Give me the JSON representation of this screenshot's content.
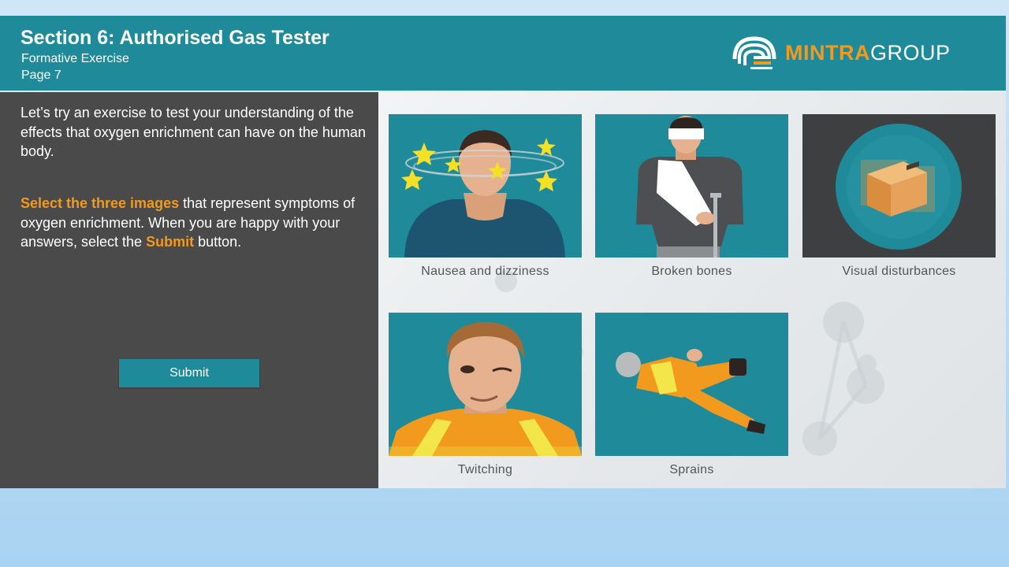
{
  "header": {
    "title": "Section 6: Authorised Gas Tester",
    "subtitle": "Formative Exercise",
    "page": "Page 7",
    "logo": {
      "word1": "MINTRA",
      "word2": "GROUP"
    }
  },
  "left_panel": {
    "intro": "Let’s try an exercise to test your understanding of the effects that oxygen enrichment can have on the human body.",
    "instruction": {
      "highlight": "Select the three images",
      "text1": " that represent symptoms of oxygen enrichment. When you are happy with your answers, select the ",
      "submit_word": "Submit",
      "text2": " button."
    },
    "submit_label": "Submit"
  },
  "options": [
    {
      "label": "Nausea and dizziness",
      "icon": "dizzy-person-icon"
    },
    {
      "label": "Broken bones",
      "icon": "broken-arm-person-icon"
    },
    {
      "label": "Visual disturbances",
      "icon": "blurred-box-icon"
    },
    {
      "label": "Twitching",
      "icon": "twitching-face-icon"
    },
    {
      "label": "Sprains",
      "icon": "falling-worker-icon"
    }
  ],
  "colors": {
    "teal": "#1f8a9a",
    "orange": "#f39a1e",
    "panel_dark": "#4a4a4a"
  }
}
